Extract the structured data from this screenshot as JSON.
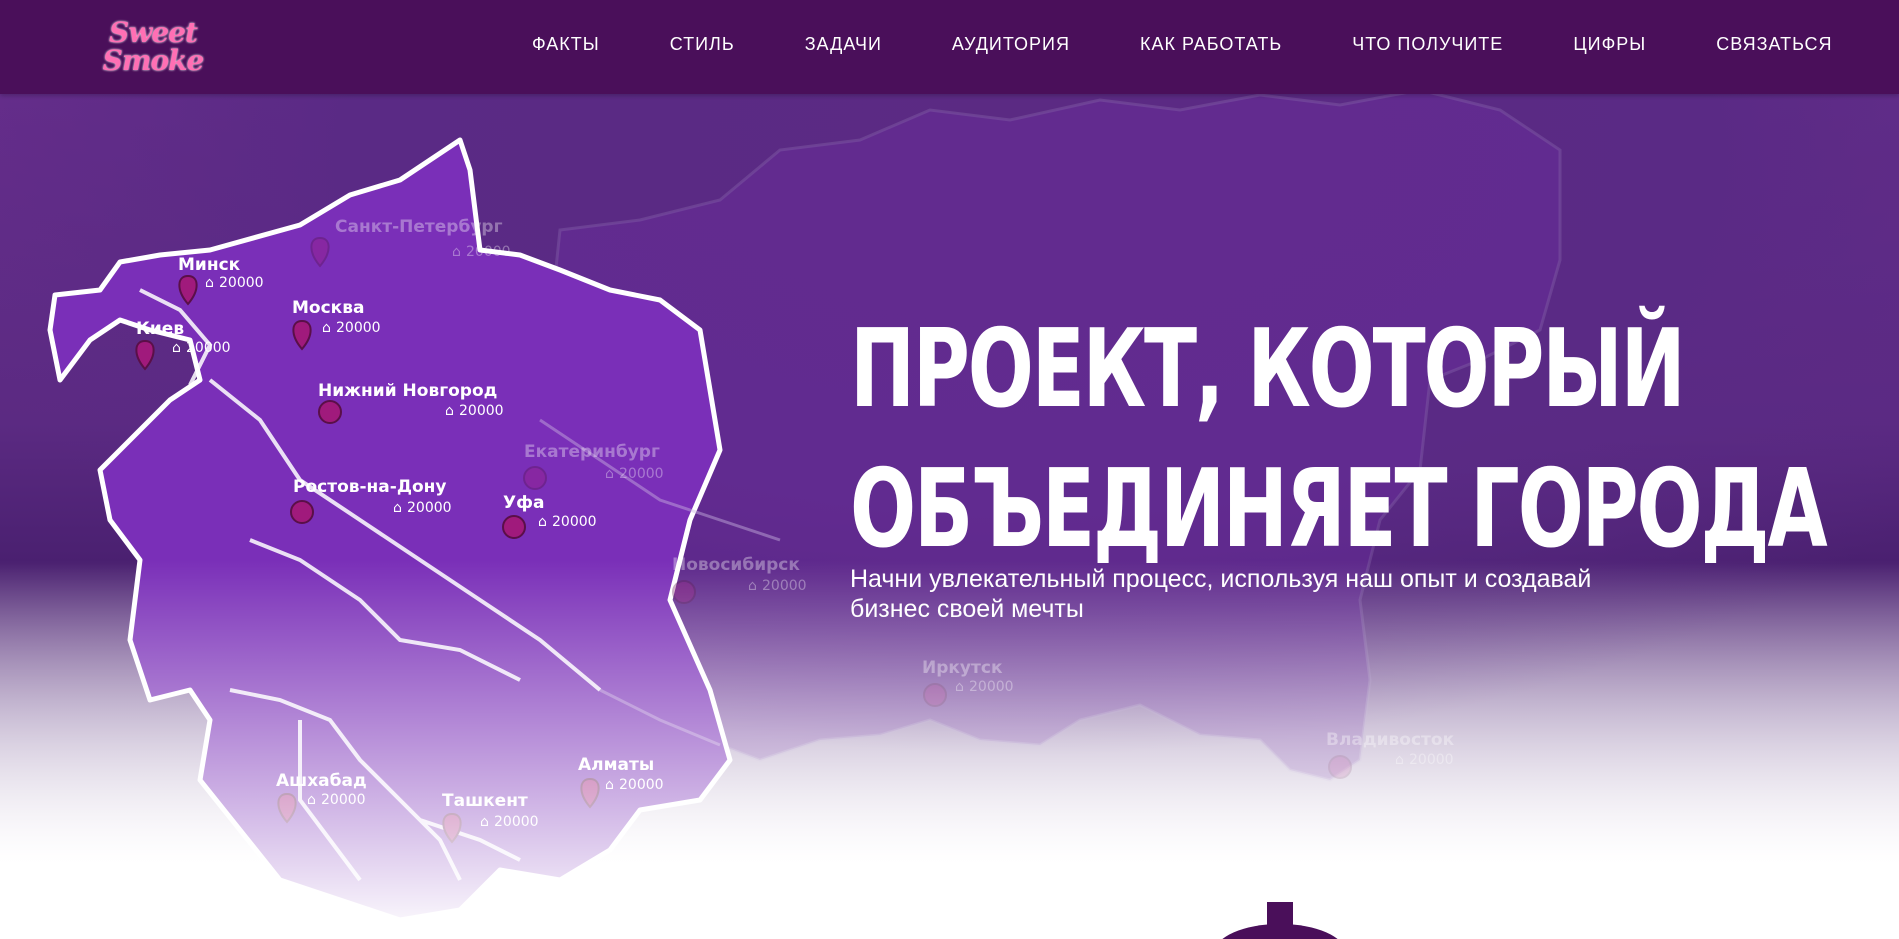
{
  "brand": {
    "logo_line1": "Sweet",
    "logo_line2": "Smoke"
  },
  "nav": {
    "items": [
      "ФАКТЫ",
      "СТИЛЬ",
      "ЗАДАЧИ",
      "АУДИТОРИЯ",
      "КАК РАБОТАТЬ",
      "ЧТО ПОЛУЧИТЕ",
      "ЦИФРЫ",
      "СВЯЗАТЬСЯ"
    ]
  },
  "hero": {
    "headline_line1": "ПРОЕКТ, КОТОРЫЙ",
    "headline_line2": "ОБЪЕДИНЯЕТ ГОРОДА",
    "subtitle": "Начни увлекательный процесс, используя наш опыт и создавай бизнес своей мечты"
  },
  "map": {
    "cities": [
      {
        "name": "Минск",
        "count": "20000"
      },
      {
        "name": "Санкт-Петербург",
        "count": "20000"
      },
      {
        "name": "Москва",
        "count": "20000"
      },
      {
        "name": "Киев",
        "count": "20000"
      },
      {
        "name": "Нижний Новгород",
        "count": "20000"
      },
      {
        "name": "Екатеринбург",
        "count": "20000"
      },
      {
        "name": "Ростов-на-Дону",
        "count": "20000"
      },
      {
        "name": "Уфа",
        "count": "20000"
      },
      {
        "name": "Новосибирск",
        "count": "20000"
      },
      {
        "name": "Иркутск",
        "count": "20000"
      },
      {
        "name": "Владивосток",
        "count": "20000"
      },
      {
        "name": "Ашхабад",
        "count": "20000"
      },
      {
        "name": "Ташкент",
        "count": "20000"
      },
      {
        "name": "Алматы",
        "count": "20000"
      }
    ]
  },
  "colors": {
    "navbar": "#4a0f5a",
    "map_fill": "#7a2fb8",
    "pin": "#a01a7c",
    "logo": "#ff6fb4"
  },
  "icons": {
    "pin": "map-pin-icon",
    "person": "person-icon"
  }
}
